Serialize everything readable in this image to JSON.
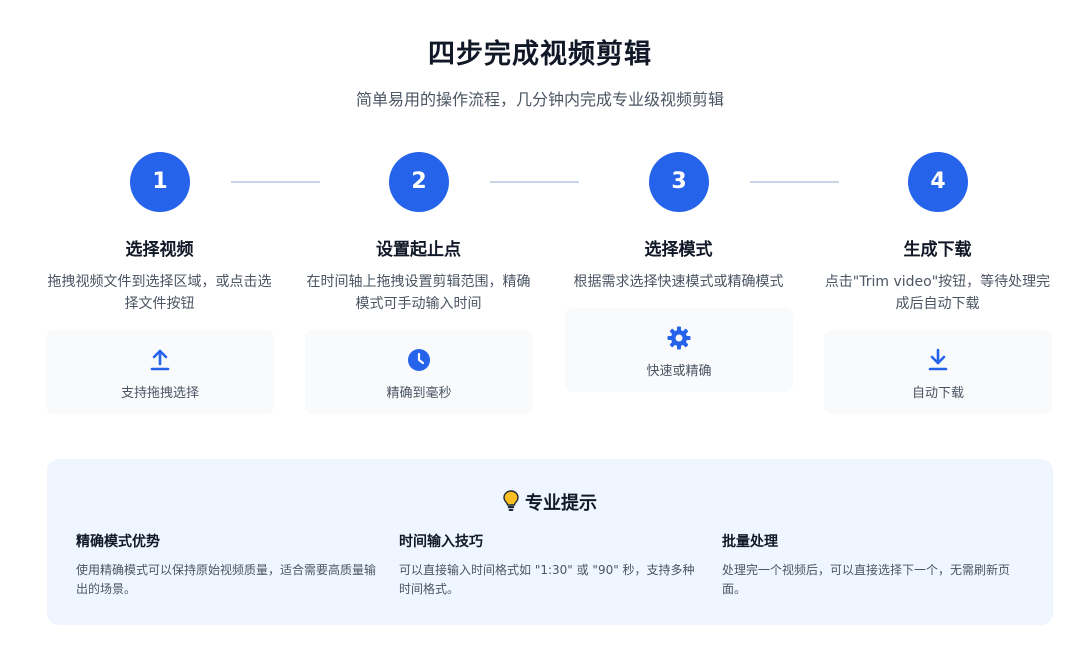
{
  "header": {
    "title": "四步完成视频剪辑",
    "subtitle": "简单易用的操作流程，几分钟内完成专业级视频剪辑"
  },
  "steps": [
    {
      "number": "1",
      "title": "选择视频",
      "desc": "拖拽视频文件到选择区域，或点击选择文件按钮",
      "card_icon": "upload-icon",
      "card_label": "支持拖拽选择"
    },
    {
      "number": "2",
      "title": "设置起止点",
      "desc": "在时间轴上拖拽设置剪辑范围，精确模式可手动输入时间",
      "card_icon": "clock-icon",
      "card_label": "精确到毫秒"
    },
    {
      "number": "3",
      "title": "选择模式",
      "desc": "根据需求选择快速模式或精确模式",
      "card_icon": "gear-icon",
      "card_label": "快速或精确"
    },
    {
      "number": "4",
      "title": "生成下载",
      "desc": "点击\"Trim video\"按钮，等待处理完成后自动下载",
      "card_icon": "download-icon",
      "card_label": "自动下载"
    }
  ],
  "tips": {
    "icon": "lightbulb-icon",
    "heading": "专业提示",
    "items": [
      {
        "title": "精确模式优势",
        "desc": "使用精确模式可以保持原始视频质量，适合需要高质量输出的场景。"
      },
      {
        "title": "时间输入技巧",
        "desc": "可以直接输入时间格式如 \"1:30\" 或 \"90\" 秒，支持多种时间格式。"
      },
      {
        "title": "批量处理",
        "desc": "处理完一个视频后，可以直接选择下一个，无需刷新页面。"
      }
    ]
  },
  "colors": {
    "accent": "#2563eb",
    "card_bg": "#f8fafc",
    "tips_bg": "#eff6ff",
    "connector": "#c7d7e8"
  }
}
